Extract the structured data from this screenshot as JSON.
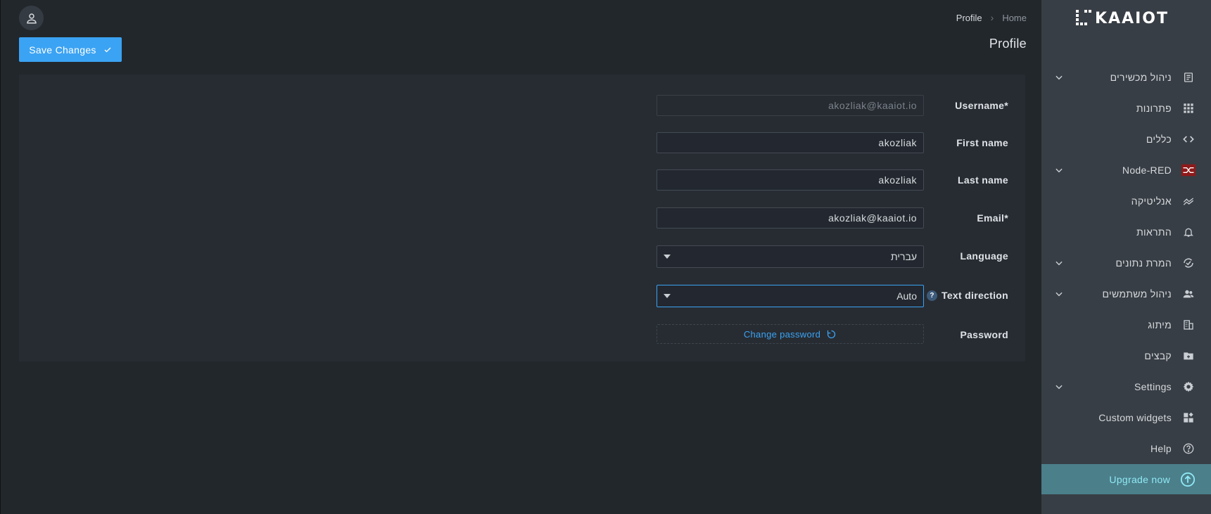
{
  "header": {
    "breadcrumb": {
      "current": "Profile",
      "home": "Home"
    },
    "page_title": "Profile",
    "save_button": "Save Changes"
  },
  "form": {
    "username": {
      "label": "Username",
      "required": "*",
      "value": "akozliak@kaaiot.io"
    },
    "first_name": {
      "label": "First name",
      "value": "akozliak"
    },
    "last_name": {
      "label": "Last name",
      "value": "akozliak"
    },
    "email": {
      "label": "Email",
      "required": "*",
      "value": "akozliak@kaaiot.io"
    },
    "language": {
      "label": "Language",
      "value": "עברית"
    },
    "text_direction": {
      "label": "Text direction",
      "value": "Auto",
      "help": "?"
    },
    "password": {
      "label": "Password",
      "action": "Change password"
    }
  },
  "sidebar": {
    "logo_text": "KAAIOT",
    "items": [
      {
        "label": "ניהול מכשירים",
        "icon": "devices-icon",
        "expandable": true
      },
      {
        "label": "פתרונות",
        "icon": "apps-grid-icon",
        "expandable": false
      },
      {
        "label": "כללים",
        "icon": "code-icon",
        "expandable": false
      },
      {
        "label": "Node-RED",
        "icon": "node-red-icon",
        "expandable": true
      },
      {
        "label": "אנליטיקה",
        "icon": "analytics-icon",
        "expandable": false
      },
      {
        "label": "התראות",
        "icon": "bell-icon",
        "expandable": false
      },
      {
        "label": "המרת נתונים",
        "icon": "sync-icon",
        "expandable": true
      },
      {
        "label": "ניהול משתמשים",
        "icon": "users-icon",
        "expandable": true
      },
      {
        "label": "מיתוג",
        "icon": "building-icon",
        "expandable": false
      },
      {
        "label": "קבצים",
        "icon": "folder-icon",
        "expandable": false
      },
      {
        "label": "Settings",
        "icon": "gear-icon",
        "expandable": true
      },
      {
        "label": "Custom widgets",
        "icon": "widgets-icon",
        "expandable": false
      },
      {
        "label": "Help",
        "icon": "help-icon",
        "expandable": false
      }
    ],
    "upgrade": "Upgrade now"
  },
  "colors": {
    "accent": "#3ba3f3",
    "sidebar": "#383e45",
    "upgrade_bg": "#4b7f8a",
    "upgrade_text": "#8fe8f5"
  }
}
